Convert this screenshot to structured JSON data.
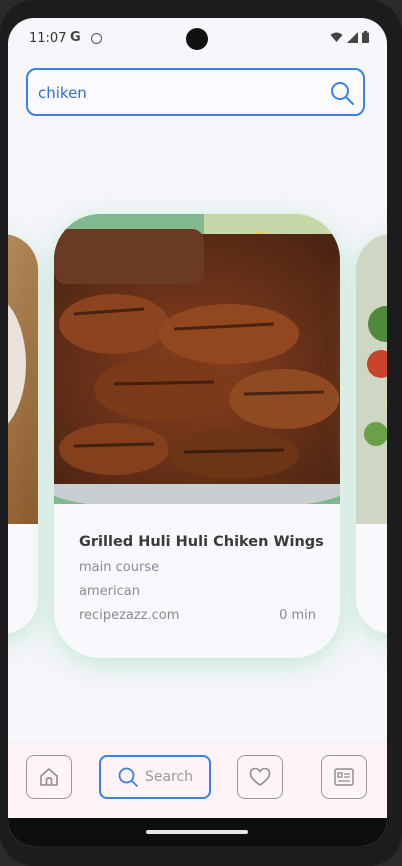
{
  "status_bar": {
    "time": "11:07",
    "g_label": "G",
    "icons": [
      "wifi-icon",
      "signal-icon",
      "battery-icon"
    ]
  },
  "search": {
    "value": "chiken",
    "icon": "search-icon"
  },
  "recipes": [
    {
      "title": "Grilled Huli Huli Chiken Wings",
      "category": "main course",
      "cuisine": "american",
      "source": "recipezazz.com",
      "time": "0 min"
    }
  ],
  "nav": {
    "home_icon": "home-icon",
    "search_label": "Search",
    "favorites_icon": "heart-icon",
    "list_icon": "recipe-list-icon"
  },
  "colors": {
    "accent": "#3b82e6",
    "card_glow": "#96dcb4",
    "nav_bg": "#fdf3f8"
  }
}
